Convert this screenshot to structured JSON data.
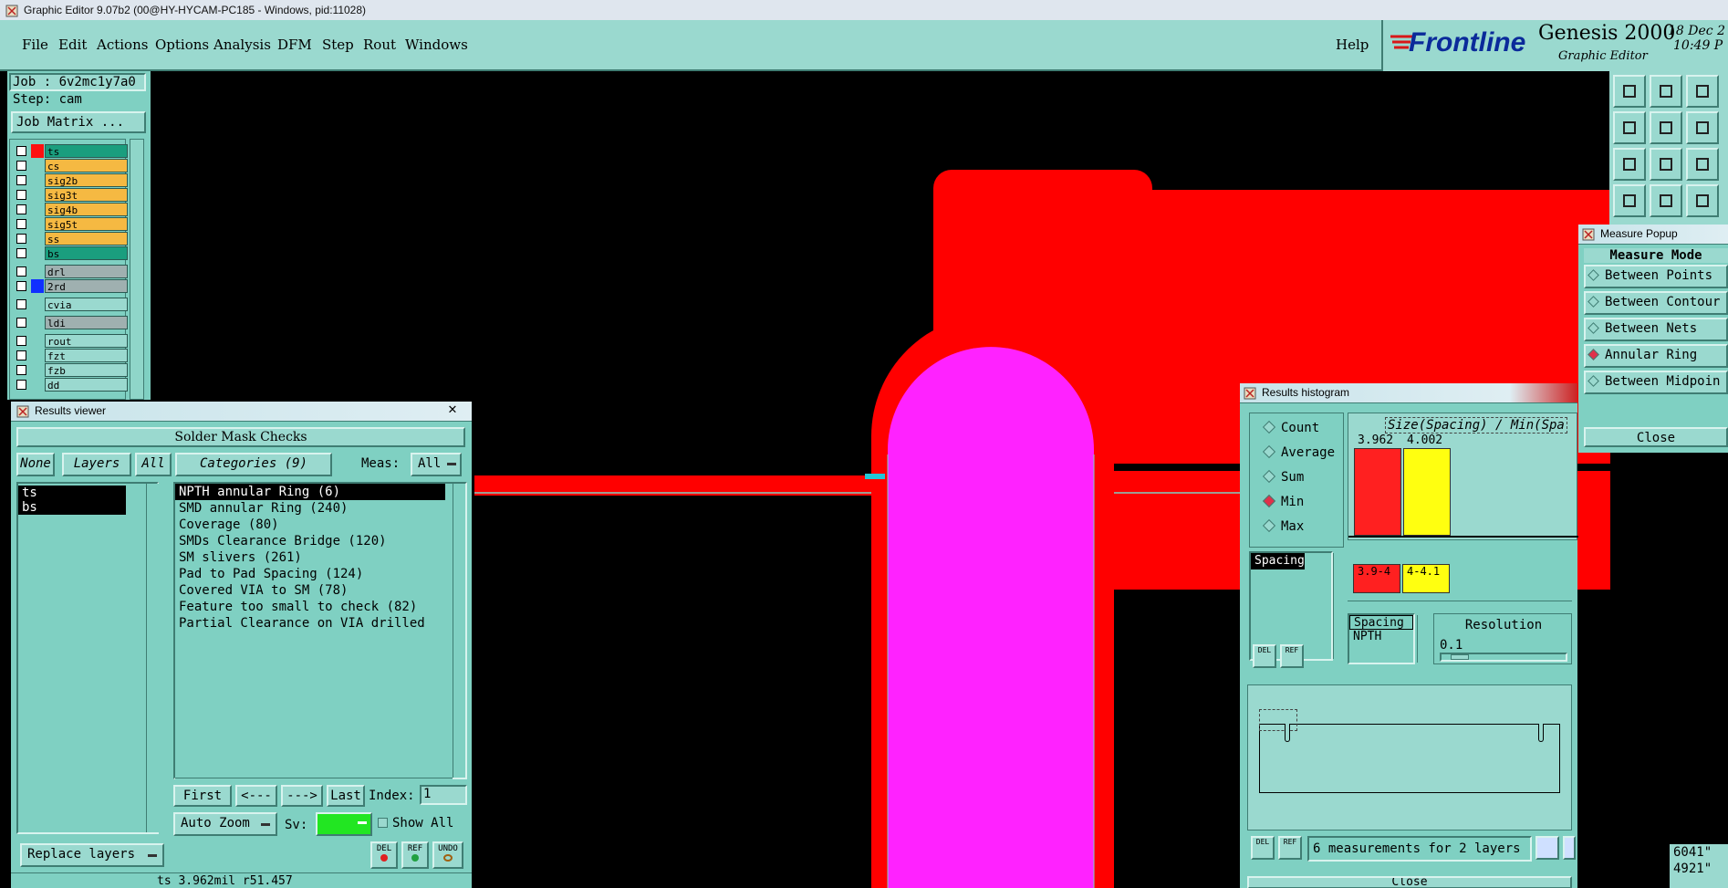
{
  "window": {
    "title": "Graphic Editor 9.07b2 (00@HY-HYCAM-PC185 - Windows, pid:11028)"
  },
  "menu": {
    "file": "File",
    "edit": "Edit",
    "actions": "Actions",
    "options": "Options",
    "analysis": "Analysis",
    "dfm": "DFM",
    "step": "Step",
    "rout": "Rout",
    "windows": "Windows",
    "help": "Help"
  },
  "brand": {
    "logo": "Frontline",
    "product": "Genesis 2000",
    "subtitle": "Graphic Editor",
    "date": "18 Dec 2",
    "time": "10:49 P"
  },
  "job": {
    "job_label": "Job : 6v2mc1y7a0",
    "step_label": "Step: cam",
    "matrix_button": "Job Matrix ..."
  },
  "layers": [
    {
      "name": "ts",
      "color": "#1a9e7e",
      "swatch": "#ff1010"
    },
    {
      "name": "cs",
      "color": "#f5b942",
      "swatch": ""
    },
    {
      "name": "sig2b",
      "color": "#f5b942",
      "swatch": ""
    },
    {
      "name": "sig3t",
      "color": "#f5b942",
      "swatch": ""
    },
    {
      "name": "sig4b",
      "color": "#f5b942",
      "swatch": ""
    },
    {
      "name": "sig5t",
      "color": "#f5b942",
      "swatch": ""
    },
    {
      "name": "ss",
      "color": "#f5b942",
      "swatch": ""
    },
    {
      "name": "bs",
      "color": "#1a9e7e",
      "swatch": ""
    },
    {
      "name": "drl",
      "color": "#9fb0b0",
      "swatch": ""
    },
    {
      "name": "2rd",
      "color": "#9fb0b0",
      "swatch": "#1030ff"
    },
    {
      "name": "cvia",
      "color": "#9ad9cf",
      "swatch": ""
    },
    {
      "name": "ldi",
      "color": "#9fb0b0",
      "swatch": ""
    },
    {
      "name": "rout",
      "color": "#9ad9cf",
      "swatch": ""
    },
    {
      "name": "fzt",
      "color": "#9ad9cf",
      "swatch": ""
    },
    {
      "name": "fzb",
      "color": "#9ad9cf",
      "swatch": ""
    },
    {
      "name": "dd",
      "color": "#9ad9cf",
      "swatch": ""
    }
  ],
  "results_viewer": {
    "title": "Results viewer",
    "header": "Solder Mask Checks",
    "none_btn": "None",
    "layers_btn": "Layers",
    "all_btn": "All",
    "categories_btn": "Categories (9)",
    "meas_label": "Meas:",
    "meas_value": "All",
    "layer_items": [
      "ts",
      "bs"
    ],
    "categories": [
      "NPTH annular Ring (6)",
      "SMD annular Ring (240)",
      "Coverage (80)",
      "SMDs Clearance Bridge (120)",
      "SM slivers (261)",
      "Pad to Pad Spacing (124)",
      "Covered VIA to SM (78)",
      "Feature too small to check (82)",
      "Partial Clearance on VIA drilled"
    ],
    "first_btn": "First",
    "prev_btn": "<---",
    "next_btn": "--->",
    "last_btn": "Last",
    "index_label": "Index:",
    "index_value": "1",
    "autozoom_btn": "Auto Zoom",
    "sv_label": "Sv:",
    "show_all": "Show All",
    "replace_btn": "Replace layers",
    "del_btn": "DEL",
    "ref_btn": "REF",
    "undo_btn": "UNDO",
    "status": "ts 3.962mil  r51.457"
  },
  "histogram": {
    "title": "Results histogram",
    "options": [
      "Count",
      "Average",
      "Sum",
      "Min",
      "Max"
    ],
    "selected": "Min",
    "chart_title": "Size(Spacing) / Min(Spa",
    "bars": [
      {
        "value": "3.962",
        "range": "3.9-4",
        "color": "#ff2020"
      },
      {
        "value": "4.002",
        "range": "4-4.1",
        "color": "#ffff10"
      }
    ],
    "spacing_item": "Spacing",
    "attr_list": [
      "Spacing",
      "NPTH"
    ],
    "resolution_label": "Resolution",
    "resolution_value": "0.1",
    "footer": "6 measurements for 2 layers",
    "close_btn": "Close",
    "del_btn": "DEL",
    "ref_btn": "REF"
  },
  "measure": {
    "title": "Measure Popup",
    "mode_label": "Measure Mode",
    "modes": [
      "Between Points",
      "Between Contour",
      "Between Nets",
      "Annular Ring",
      "Between Midpoin"
    ],
    "selected": "Annular Ring",
    "close_btn": "Close"
  },
  "coords": {
    "x": "6041\"",
    "y": "4921\""
  },
  "toolbar_icons": [
    "zoom-home-icon",
    "zoom-in-icon",
    "home-icon",
    "pan-left-icon",
    "pan-right-icon",
    "redraw-icon",
    "fit-icon",
    "center-icon",
    "scale-1-2-icon",
    "measure-icon",
    "grid-icon",
    "snap-icon"
  ]
}
